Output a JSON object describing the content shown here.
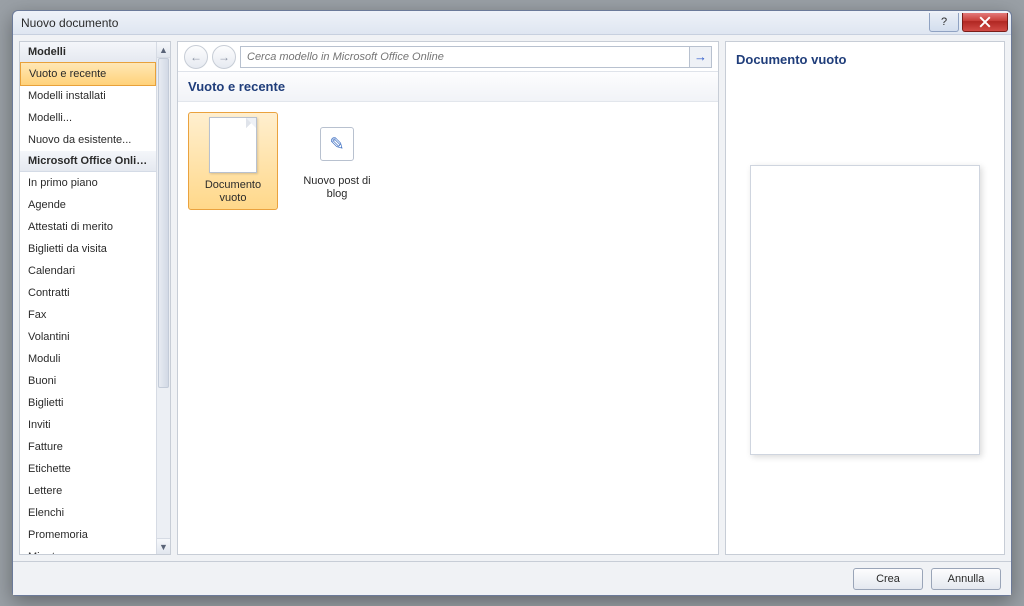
{
  "window": {
    "title": "Nuovo documento",
    "help_label": "?",
    "close_label": "×"
  },
  "sidebar": {
    "header_templates": "Modelli",
    "header_online": "Microsoft Office Online",
    "group_templates": [
      {
        "label": "Vuoto e recente",
        "selected": true
      },
      {
        "label": "Modelli installati"
      },
      {
        "label": "Modelli..."
      },
      {
        "label": "Nuovo da esistente..."
      }
    ],
    "group_online": [
      {
        "label": "In primo piano"
      },
      {
        "label": "Agende"
      },
      {
        "label": "Attestati di merito"
      },
      {
        "label": "Biglietti da visita"
      },
      {
        "label": "Calendari"
      },
      {
        "label": "Contratti"
      },
      {
        "label": "Fax"
      },
      {
        "label": "Volantini"
      },
      {
        "label": "Moduli"
      },
      {
        "label": "Buoni"
      },
      {
        "label": "Biglietti"
      },
      {
        "label": "Inviti"
      },
      {
        "label": "Fatture"
      },
      {
        "label": "Etichette"
      },
      {
        "label": "Lettere"
      },
      {
        "label": "Elenchi"
      },
      {
        "label": "Promemoria"
      },
      {
        "label": "Minute"
      }
    ]
  },
  "toolbar": {
    "back_glyph": "←",
    "forward_glyph": "→",
    "search_placeholder": "Cerca modello in Microsoft Office Online",
    "go_glyph": "→"
  },
  "main": {
    "section_title": "Vuoto e recente",
    "templates": [
      {
        "label": "Documento vuoto",
        "icon": "blank-doc",
        "selected": true
      },
      {
        "label": "Nuovo post di blog",
        "icon": "blog-post",
        "selected": false
      }
    ]
  },
  "preview": {
    "title": "Documento vuoto"
  },
  "footer": {
    "create": "Crea",
    "cancel": "Annulla"
  }
}
